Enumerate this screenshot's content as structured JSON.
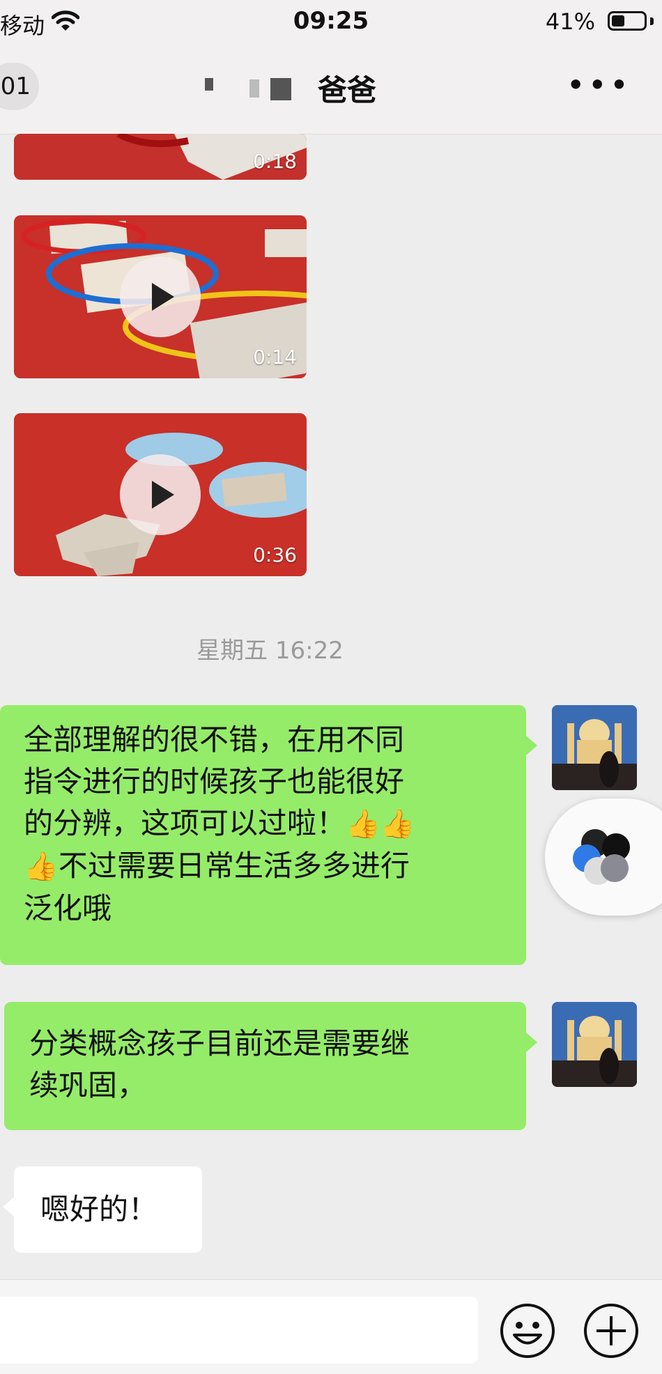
{
  "status_bar": {
    "carrier": "移动",
    "time": "09:25",
    "battery": "41%",
    "battery_level": 0.41
  },
  "nav": {
    "back_count": "01",
    "title": "爸爸",
    "more": "•••"
  },
  "messages": {
    "videos": [
      {
        "duration": "0:18"
      },
      {
        "duration": "0:14"
      },
      {
        "duration": "0:36"
      }
    ],
    "timestamp": "星期五 16:22",
    "bubble1": {
      "line1": "全部理解的很不错，在用不同",
      "line2": "指令进行的时候孩子也能很好",
      "line3": "的分辨，这项可以过啦！",
      "line4": "不过需要日常生活多多进行",
      "line5": "泛化哦",
      "emoji": "👍"
    },
    "bubble2": {
      "line1": "分类概念孩子目前还是需要继",
      "line2": "续巩固，"
    },
    "bubble3": {
      "text": "嗯好的！"
    }
  },
  "icons": {
    "wifi": "wifi-icon",
    "play": "play-icon",
    "emoji": "emoji-icon",
    "plus": "plus-icon",
    "more": "more-icon"
  },
  "colors": {
    "bubble_sent": "#95ec69",
    "bubble_received": "#ffffff",
    "background": "#ededed"
  }
}
